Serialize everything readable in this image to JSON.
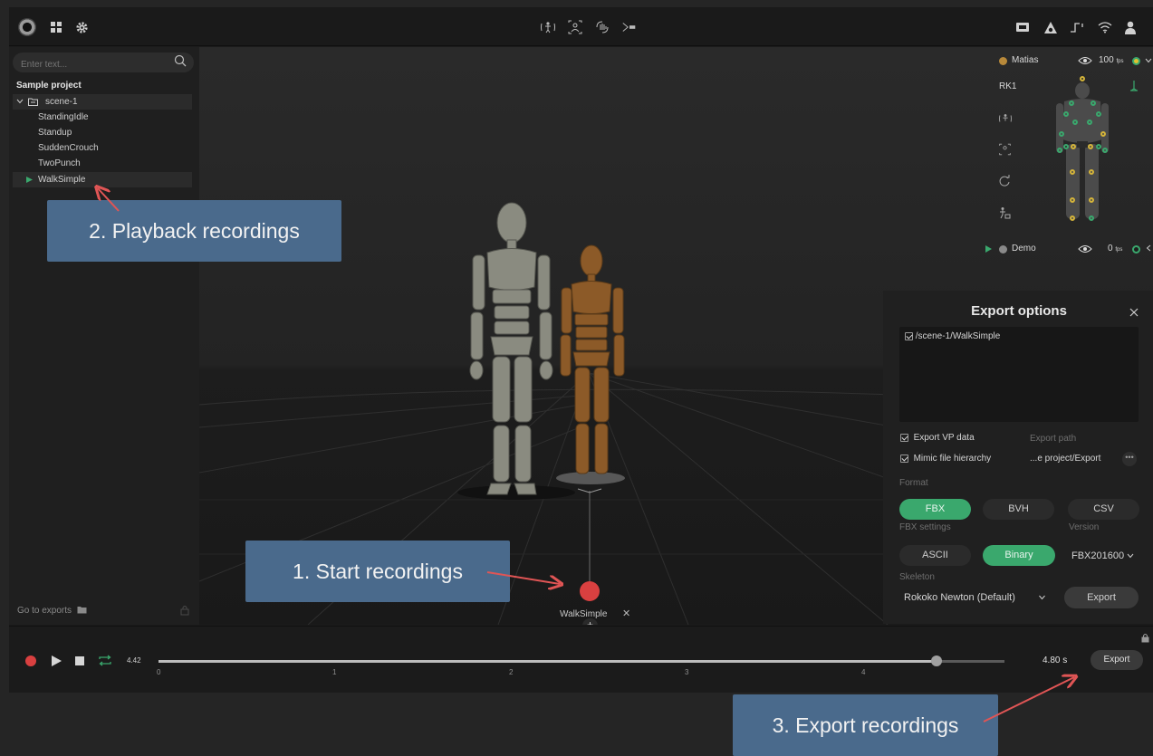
{
  "topbar": {
    "center_icons": [
      "body-suit-icon",
      "face-capture-icon",
      "hand-capture-icon",
      "camera-stream-icon"
    ],
    "right_icons": [
      "device-icon",
      "triangle-icon",
      "trigger-icon",
      "wifi-icon",
      "user-icon"
    ]
  },
  "sidebar": {
    "search_placeholder": "Enter text...",
    "project_title": "Sample project",
    "scene": "scene-1",
    "recordings": [
      "StandingIdle",
      "Standup",
      "SuddenCrouch",
      "TwoPunch",
      "WalkSimple"
    ],
    "go_to_exports": "Go to exports"
  },
  "characters": [
    {
      "name": "Matias",
      "fps": "100",
      "unit": "fps",
      "color": "#b8893a"
    },
    {
      "name": "Demo",
      "fps": "0",
      "unit": "fps",
      "color": "#8a8a8a"
    }
  ],
  "suit_label": "RK1",
  "viewport": {
    "clip_label": "WalkSimple",
    "close_glyph": "✕",
    "add_glyph": "+"
  },
  "export_options": {
    "title": "Export options",
    "file_item": "/scene-1/WalkSimple",
    "export_vp_data": "Export VP data",
    "mimic_hierarchy": "Mimic file hierarchy",
    "export_path_label": "Export path",
    "export_path_value": "...e project/Export",
    "format_label": "Format",
    "formats": [
      "FBX",
      "BVH",
      "CSV"
    ],
    "fbx_settings_label": "FBX settings",
    "fbx_modes": [
      "ASCII",
      "Binary"
    ],
    "version_label": "Version",
    "version_value": "FBX201600",
    "skeleton_label": "Skeleton",
    "skeleton_value": "Rokoko Newton (Default)",
    "export_button": "Export"
  },
  "timeline": {
    "current_time": "4.42",
    "total_time": "4.80 s",
    "ticks": [
      "0",
      "1",
      "2",
      "3",
      "4"
    ],
    "progress": 0.92,
    "export_button": "Export"
  },
  "annotations": {
    "start": "1. Start recordings",
    "playback": "2. Playback recordings",
    "export": "3. Export recordings"
  },
  "colors": {
    "accent_green": "#3aa86d",
    "record_red": "#d94040",
    "callout": "#4a6a8c",
    "arrow": "#e05555"
  }
}
